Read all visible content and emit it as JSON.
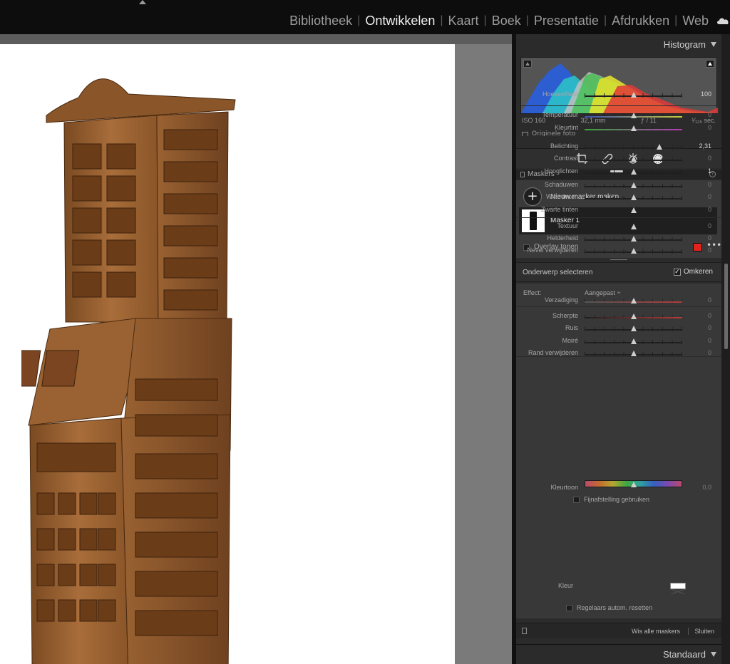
{
  "modules": [
    "Bibliotheek",
    "Ontwikkelen",
    "Kaart",
    "Boek",
    "Presentatie",
    "Afdrukken",
    "Web"
  ],
  "active_module": "Ontwikkelen",
  "histogram": {
    "title": "Histogram",
    "iso": "ISO 160",
    "focal": "32,1 mm",
    "aperture": "ƒ / 11",
    "shutter": "¹⁄₁₂₅ sec.",
    "original_label": "Originele foto"
  },
  "masks": {
    "title": "Maskers",
    "new_mask": "Nieuw masker maken",
    "mask_name": "Masker 1",
    "overlay_label": "Overlay tonen",
    "overlay_color": "#e0241b"
  },
  "subject": {
    "label": "Onderwerp selecteren",
    "invert_label": "Omkeren",
    "invert_checked": true
  },
  "effect": {
    "label": "Effect:",
    "value": "Aangepast ÷"
  },
  "sliders": [
    {
      "label": "Hoeveelheid",
      "value": "100",
      "pos": 0.5,
      "strong": true
    },
    {
      "label": "Temperatuur",
      "value": "0",
      "pos": 0.5
    },
    {
      "label": "Kleurtint",
      "value": "0",
      "pos": 0.5
    },
    {
      "label": "Belichting",
      "value": "2,31",
      "pos": 0.77,
      "strong": true
    },
    {
      "label": "Contrast",
      "value": "0",
      "pos": 0.5
    },
    {
      "label": "Hooglichten",
      "value": "1",
      "pos": 0.5,
      "strong": true
    },
    {
      "label": "Schaduwen",
      "value": "0",
      "pos": 0.5
    },
    {
      "label": "Witte tinten",
      "value": "0",
      "pos": 0.5
    },
    {
      "label": "Zwarte tinten",
      "value": "0",
      "pos": 0.5
    },
    {
      "label": "Textuur",
      "value": "0",
      "pos": 0.5
    },
    {
      "label": "Helderheid",
      "value": "0",
      "pos": 0.5
    },
    {
      "label": "Nevel verwijderen",
      "value": "0",
      "pos": 0.5
    },
    {
      "label": "Verzadiging",
      "value": "0",
      "pos": 0.5
    },
    {
      "label": "Scherpte",
      "value": "0",
      "pos": 0.5
    },
    {
      "label": "Ruis",
      "value": "0",
      "pos": 0.5
    },
    {
      "label": "Moiré",
      "value": "0",
      "pos": 0.5
    },
    {
      "label": "Rand verwijderen",
      "value": "0",
      "pos": 0.5
    }
  ],
  "hue": {
    "label": "Kleurtoon",
    "value": "0,0",
    "fine_label": "Fijnafstelling gebruiken"
  },
  "color_label": "Kleur",
  "reset_label": "Regelaars autom. resetten",
  "footer": {
    "clear_all": "Wis alle maskers",
    "close": "Sluiten"
  },
  "standard": "Standaard",
  "tools": [
    "crop-icon",
    "heal-icon",
    "redeye-icon",
    "mask-icon"
  ]
}
